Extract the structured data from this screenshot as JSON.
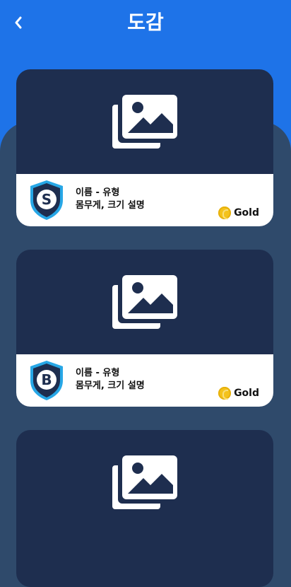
{
  "header": {
    "title": "도감"
  },
  "cards": [
    {
      "grade": "S",
      "line1": "이름 - 유형",
      "line2": "몸무게, 크기 설명",
      "currency": "Gold"
    },
    {
      "grade": "B",
      "line1": "이름 - 유형",
      "line2": "몸무게, 크기 설명",
      "currency": "Gold"
    },
    {
      "grade": "",
      "line1": "",
      "line2": "",
      "currency": ""
    }
  ]
}
